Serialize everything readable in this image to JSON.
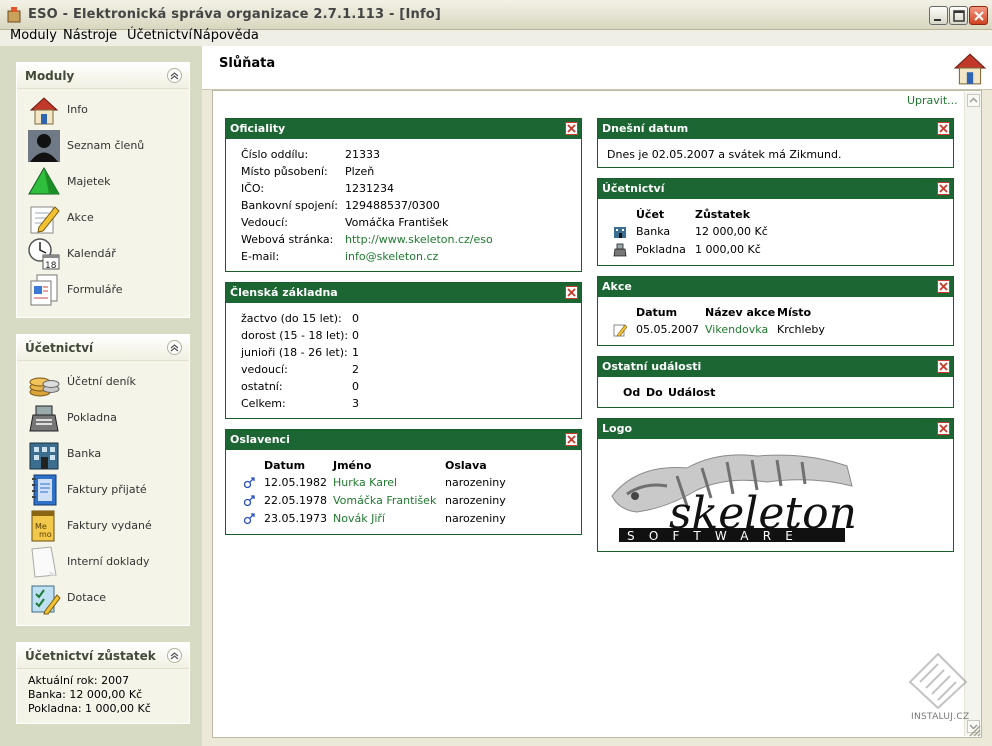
{
  "window": {
    "title": "ESO - Elektronická správa organizace 2.7.1.113 - [Info]"
  },
  "menu": [
    "Moduly",
    "Nástroje",
    "Účetnictví",
    "Nápověda"
  ],
  "sidebar": {
    "modules": {
      "title": "Moduly",
      "items": [
        {
          "label": "Info",
          "icon": "house-icon"
        },
        {
          "label": "Seznam členů",
          "icon": "person-silhouette-icon"
        },
        {
          "label": "Majetek",
          "icon": "pyramid-icon"
        },
        {
          "label": "Akce",
          "icon": "pencil-notepad-icon"
        },
        {
          "label": "Kalendář",
          "icon": "clock-calendar-icon"
        },
        {
          "label": "Formuláře",
          "icon": "form-documents-icon"
        }
      ]
    },
    "accounting": {
      "title": "Účetnictví",
      "items": [
        {
          "label": "Účetní deník",
          "icon": "coins-icon"
        },
        {
          "label": "Pokladna",
          "icon": "cash-register-icon"
        },
        {
          "label": "Banka",
          "icon": "bank-icon"
        },
        {
          "label": "Faktury přijaté",
          "icon": "blue-notebook-icon"
        },
        {
          "label": "Faktury vydané",
          "icon": "memo-pad-icon"
        },
        {
          "label": "Interní doklady",
          "icon": "blank-page-icon"
        },
        {
          "label": "Dotace",
          "icon": "checklist-icon"
        }
      ]
    },
    "balance": {
      "title": "Účetnictví zůstatek",
      "lines": [
        "Aktuální rok: 2007",
        "Banka: 12 000,00 Kč",
        "Pokladna: 1 000,00 Kč"
      ]
    }
  },
  "main": {
    "title": "Slůňata",
    "edit_link": "Upravit...",
    "officialities": {
      "title": "Oficiality",
      "rows": [
        {
          "label": "Číslo oddílu:",
          "value": "21333"
        },
        {
          "label": "Místo působení:",
          "value": "Plzeň"
        },
        {
          "label": "IČO:",
          "value": "1231234"
        },
        {
          "label": "Bankovní spojení:",
          "value": "129488537/0300"
        },
        {
          "label": "Vedoucí:",
          "value": "Vomáčka František"
        },
        {
          "label": "Webová stránka:",
          "value": "http://www.skeleton.cz/eso"
        },
        {
          "label": "E-mail:",
          "value": "info@skeleton.cz"
        }
      ]
    },
    "members": {
      "title": "Členská základna",
      "rows": [
        {
          "label": "žactvo (do 15 let):",
          "value": "0"
        },
        {
          "label": "dorost (15 - 18 let):",
          "value": "0"
        },
        {
          "label": "junioři (18 - 26 let):",
          "value": "1"
        },
        {
          "label": "vedoucí:",
          "value": "2"
        },
        {
          "label": "ostatní:",
          "value": "0"
        },
        {
          "label": "Celkem:",
          "value": "3"
        }
      ]
    },
    "birthdays": {
      "title": "Oslavenci",
      "headers": [
        "Datum",
        "Jméno",
        "Oslava"
      ],
      "rows": [
        {
          "date": "12.05.1982",
          "name": "Hurka Karel",
          "type": "narozeniny"
        },
        {
          "date": "22.05.1978",
          "name": "Vomáčka František",
          "type": "narozeniny"
        },
        {
          "date": "23.05.1973",
          "name": "Novák Jiří",
          "type": "narozeniny"
        }
      ]
    },
    "today": {
      "title": "Dnešní datum",
      "text": "Dnes je 02.05.2007 a svátek má Zikmund."
    },
    "accounts": {
      "title": "Účetnictví",
      "headers": [
        "Účet",
        "Zůstatek"
      ],
      "rows": [
        {
          "account": "Banka",
          "balance": "12 000,00 Kč"
        },
        {
          "account": "Pokladna",
          "balance": "1 000,00 Kč"
        }
      ]
    },
    "events": {
      "title": "Akce",
      "headers": [
        "Datum",
        "Název akce",
        "Místo"
      ],
      "rows": [
        {
          "date": "05.05.2007",
          "name": "Vikendovka",
          "place": "Krchleby"
        }
      ]
    },
    "other_events": {
      "title": "Ostatní události",
      "headers": [
        "Od",
        "Do",
        "Událost"
      ]
    },
    "logo": {
      "title": "Logo",
      "brand": "skeleton",
      "tagline": "SOFTWARE"
    }
  },
  "watermark": "INSTALUJ.CZ",
  "colors": {
    "widget_header": "#1b6632",
    "link": "#1f7a2f",
    "sidebar_bg": "#d8dbc4"
  }
}
